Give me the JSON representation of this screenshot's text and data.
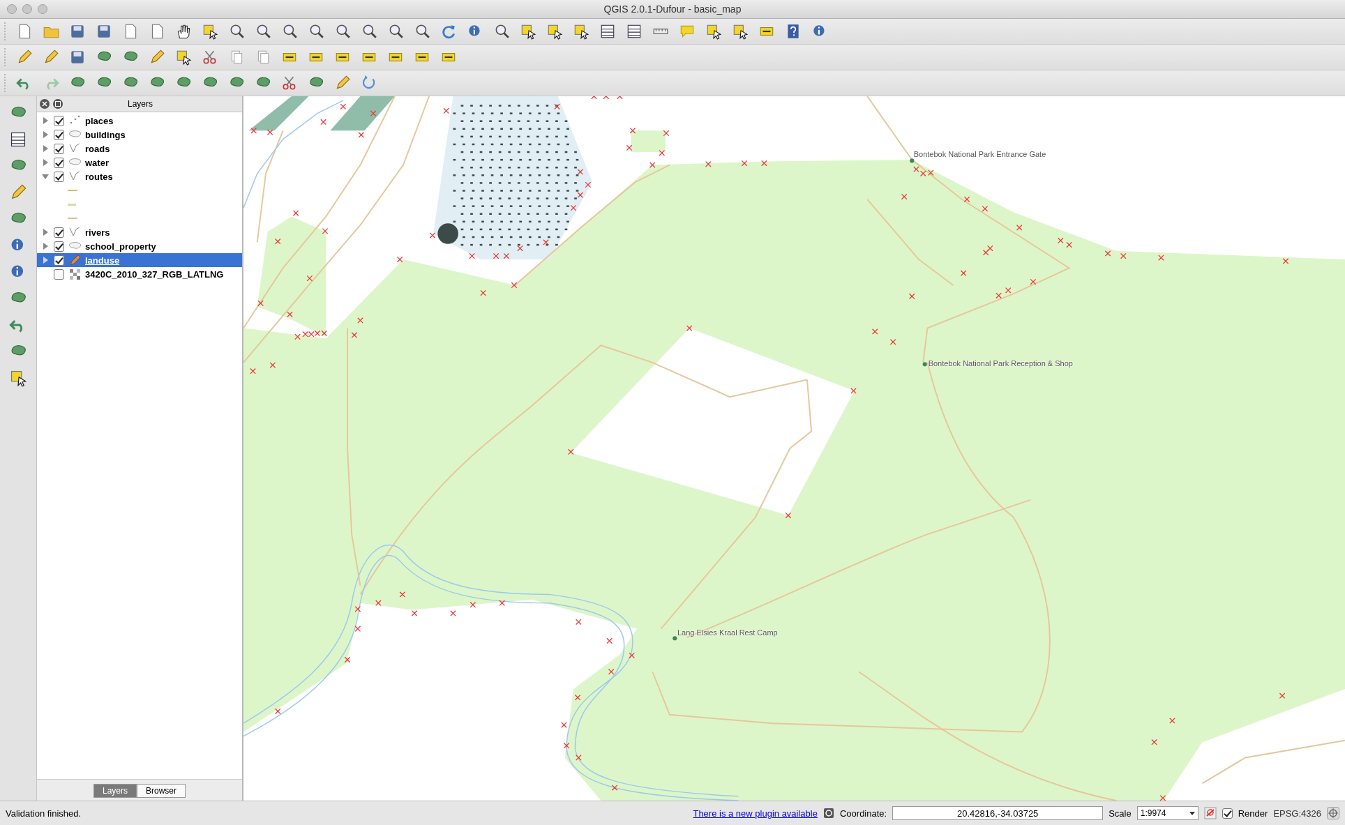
{
  "window": {
    "title": "QGIS 2.0.1-Dufour - basic_map"
  },
  "layers_panel": {
    "title": "Layers",
    "layers": [
      {
        "name": "places",
        "kind": "point",
        "checked": true,
        "expanded": false,
        "selected": false
      },
      {
        "name": "buildings",
        "kind": "polygon",
        "checked": true,
        "expanded": false,
        "selected": false
      },
      {
        "name": "roads",
        "kind": "line",
        "checked": true,
        "expanded": false,
        "selected": false
      },
      {
        "name": "water",
        "kind": "polygon",
        "checked": true,
        "expanded": false,
        "selected": false
      },
      {
        "name": "routes",
        "kind": "line",
        "checked": true,
        "expanded": true,
        "selected": false,
        "legend": [
          {
            "color": "#e8b56a"
          },
          {
            "color": "#e3cf9a"
          },
          {
            "color": "#dcc383"
          }
        ]
      },
      {
        "name": "rivers",
        "kind": "line",
        "checked": true,
        "expanded": false,
        "selected": false
      },
      {
        "name": "school_property",
        "kind": "polygon",
        "checked": true,
        "expanded": false,
        "selected": false
      },
      {
        "name": "landuse",
        "kind": "editing",
        "checked": true,
        "expanded": false,
        "selected": true
      },
      {
        "name": "3420C_2010_327_RGB_LATLNG",
        "kind": "raster",
        "checked": false,
        "selected": false
      }
    ],
    "tabs": [
      {
        "label": "Layers",
        "selected": true
      },
      {
        "label": "Browser",
        "selected": false
      }
    ]
  },
  "map": {
    "labels": [
      "Bontebok National Park Entrance Gate",
      "Bontebok National Park Reception & Shop",
      "Lang Elsies Kraal Rest Camp"
    ]
  },
  "status_bar": {
    "message": "Validation finished.",
    "plugin_link": "There is a new plugin available",
    "coordinate_label": "Coordinate:",
    "coordinate": "20.42816,-34.03725",
    "scale_label": "Scale",
    "scale": "1:9974",
    "render_checked": true,
    "render_label": "Render",
    "crs": "EPSG:4326"
  }
}
